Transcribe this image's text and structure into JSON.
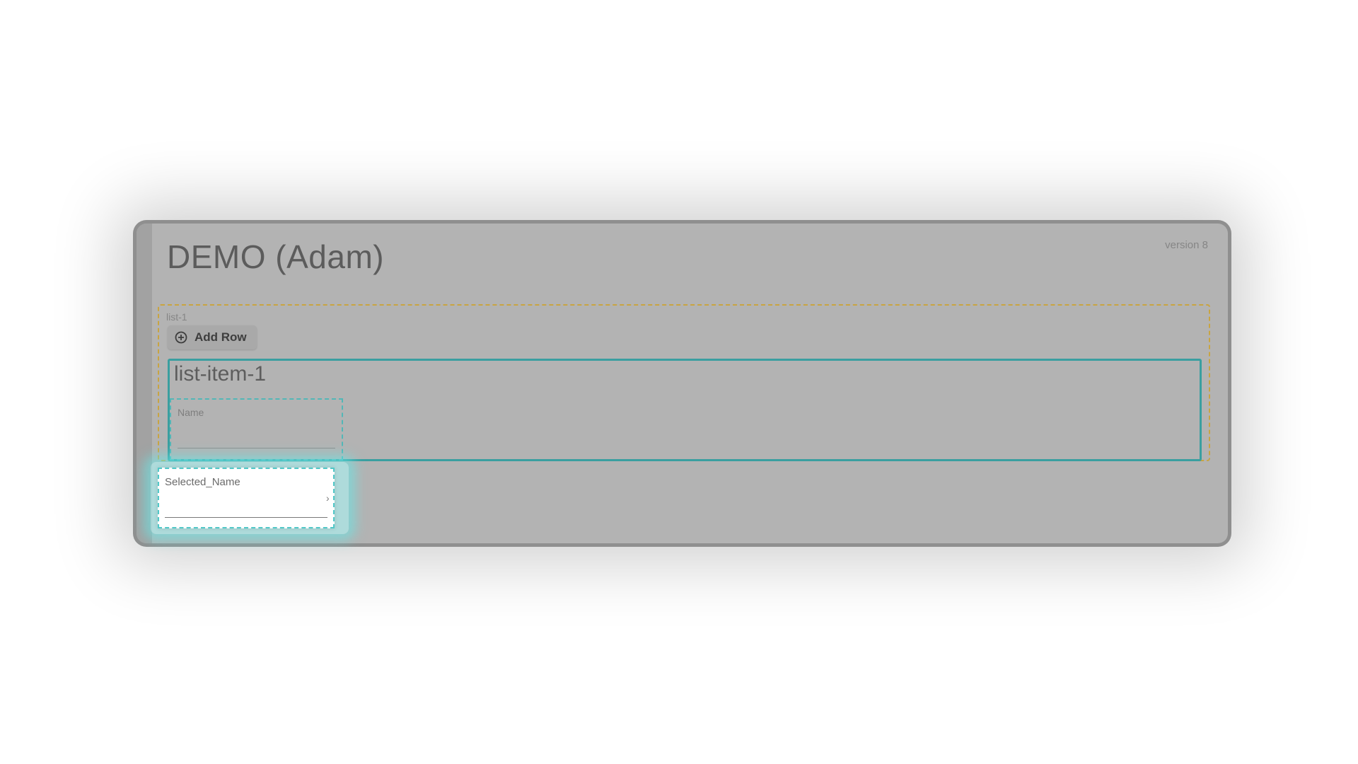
{
  "app": {
    "title": "DEMO (Adam)",
    "version": "version 8"
  },
  "list": {
    "label": "list-1",
    "add_row_label": "Add Row",
    "items": [
      {
        "title": "list-item-1",
        "name_field": {
          "label": "Name",
          "value": ""
        }
      }
    ]
  },
  "selected_field": {
    "label": "Selected_Name",
    "value": "",
    "chevron": "›"
  },
  "icons": {
    "add_row": "plus-circle-icon",
    "selected": "chevron-right-icon"
  },
  "colors": {
    "list_border": "#c9a441",
    "item_border": "#3a9fa0",
    "highlight": "#64ebeb"
  }
}
